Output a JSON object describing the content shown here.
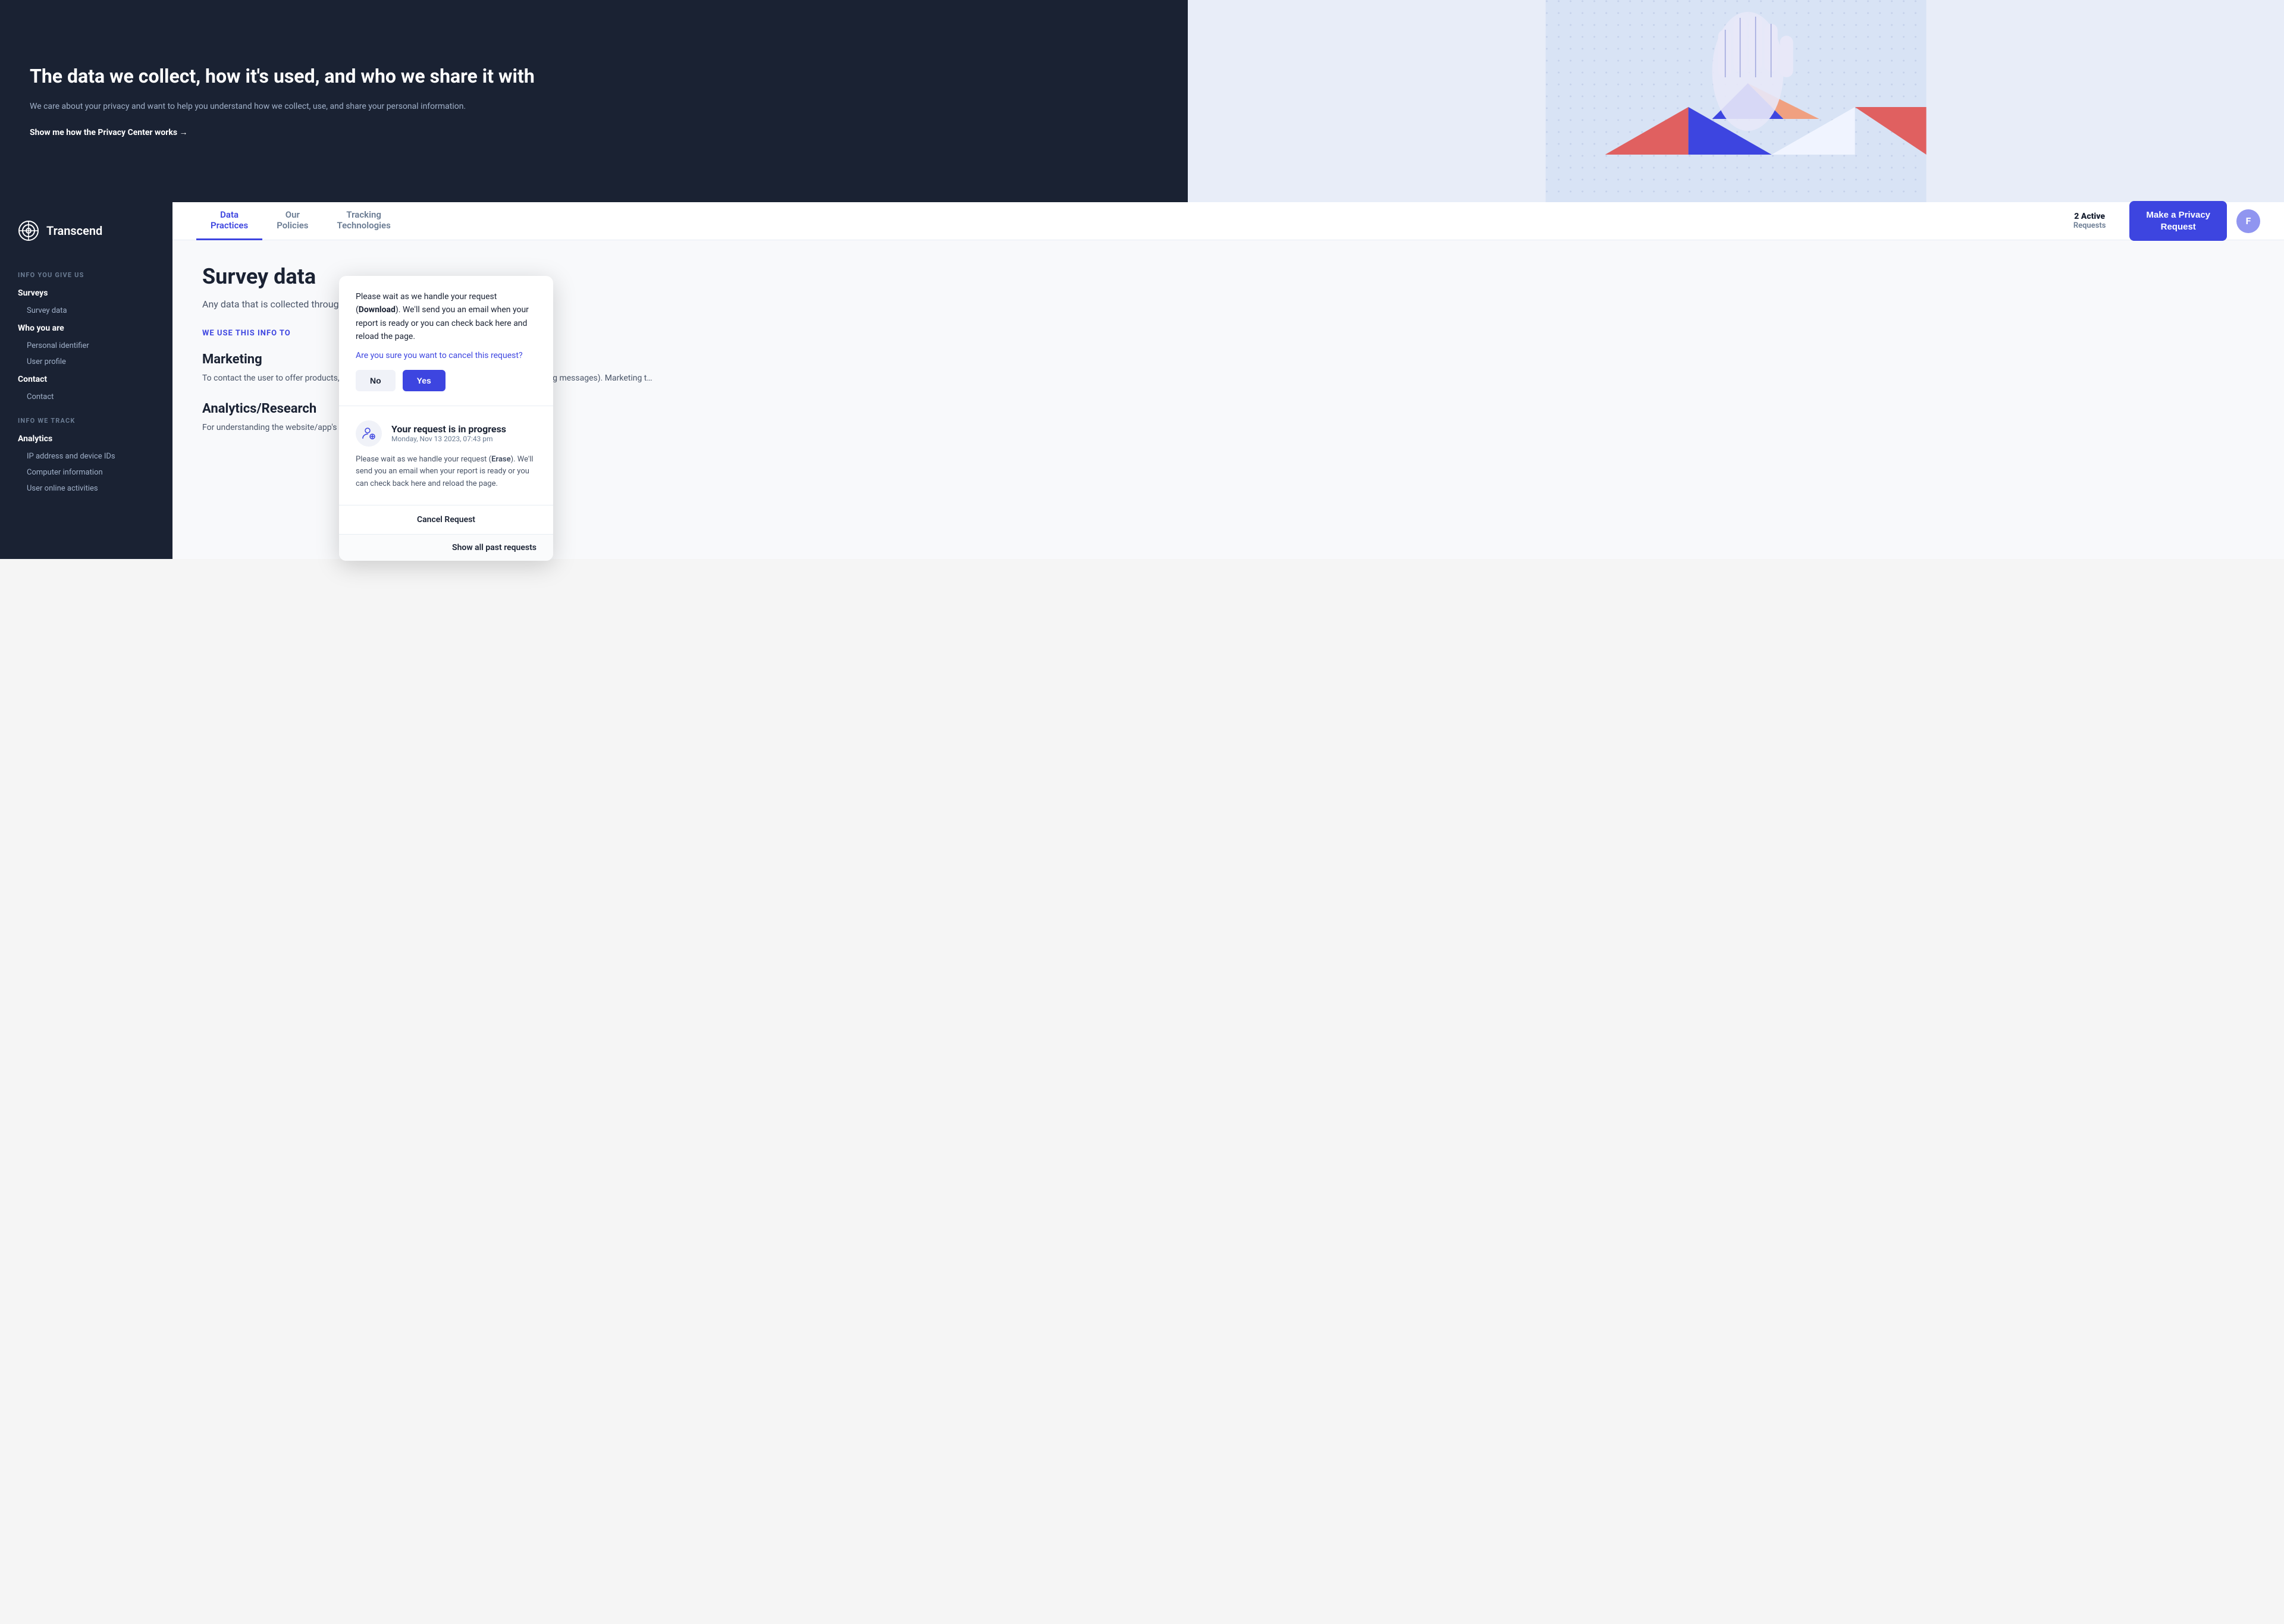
{
  "hero": {
    "title": "The data we collect, how it's used, and who we share it with",
    "subtitle": "We care about your privacy and want to help you understand how we collect, use, and share your personal information.",
    "link_text": "Show me how the Privacy Center works →"
  },
  "logo": {
    "text": "Transcend"
  },
  "sidebar": {
    "section_info_give": "INFO YOU GIVE US",
    "group_surveys": "Surveys",
    "item_survey_data": "Survey data",
    "group_who_you_are": "Who you are",
    "item_personal_identifier": "Personal identifier",
    "item_user_profile": "User profile",
    "group_contact": "Contact",
    "item_contact": "Contact",
    "section_info_track": "INFO WE TRACK",
    "group_analytics": "Analytics",
    "item_ip": "IP address and device IDs",
    "item_computer": "Computer information",
    "item_user_online": "User online activities"
  },
  "nav": {
    "tab_data": "Data\nPractices",
    "tab_policies": "Our\nPolicies",
    "tab_tracking": "Tracking\nTechnologies",
    "active_requests_count": "2 Active",
    "active_requests_label": "Requests",
    "privacy_btn_line1": "Make a Privacy",
    "privacy_btn_line2": "Request",
    "avatar_letter": "F"
  },
  "main": {
    "section_title": "Survey data",
    "section_desc": "Any data that is collected through surveys",
    "we_use_label": "WE USE THIS INFO TO",
    "use_items": [
      {
        "title": "Marketing",
        "desc": "To contact the user to offer products, services (e.g. emails, calling or texting user with marketing messages). Marketing t…"
      },
      {
        "title": "Analytics/Research",
        "desc": "For understanding the website/app's a… y strategy, or general research."
      }
    ]
  },
  "popup": {
    "cancel_desc": "Please wait as we handle your request (Download). We'll send you an email when your report is ready or you can check back here and reload the page.",
    "cancel_question": "Are you sure you want to cancel this request?",
    "btn_no": "No",
    "btn_yes": "Yes",
    "progress_title": "Your request is in progress",
    "progress_date": "Monday, Nov 13 2023, 07:43 pm",
    "progress_desc": "Please wait as we handle your request (Erase). We'll send you an email when your report is ready or you can check back here and reload the page.",
    "progress_request_type": "Erase",
    "cancel_req_label": "Cancel Request",
    "show_past_label": "Show all past requests"
  }
}
